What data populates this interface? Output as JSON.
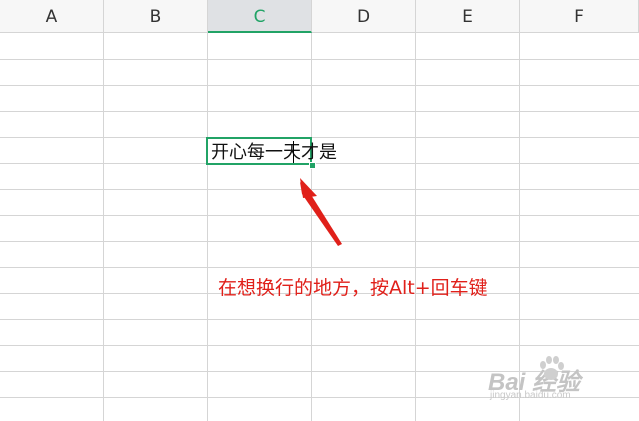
{
  "columns": [
    "A",
    "B",
    "C",
    "D",
    "E",
    "F"
  ],
  "active_column": "C",
  "cell": {
    "text_before_cursor": "开心每一",
    "text_after_cursor": "天才是"
  },
  "annotation": {
    "text": "在想换行的地方，按Alt+回车键",
    "color": "#e0201a"
  },
  "watermark": {
    "brand": "Bai  经验",
    "url": "jingyan.baidu.com"
  },
  "colors": {
    "accent_green": "#21a366",
    "grid": "#d5d5d5",
    "header_bg": "#f7f7f7"
  }
}
